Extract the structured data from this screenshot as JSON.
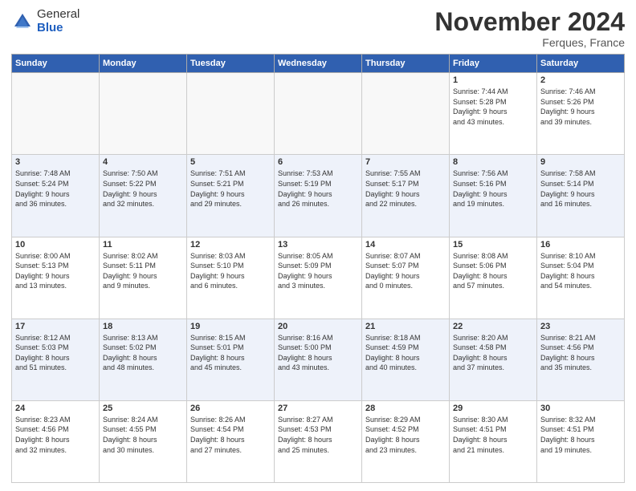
{
  "header": {
    "logo_general": "General",
    "logo_blue": "Blue",
    "month": "November 2024",
    "location": "Ferques, France"
  },
  "weekdays": [
    "Sunday",
    "Monday",
    "Tuesday",
    "Wednesday",
    "Thursday",
    "Friday",
    "Saturday"
  ],
  "weeks": [
    [
      {
        "day": "",
        "info": ""
      },
      {
        "day": "",
        "info": ""
      },
      {
        "day": "",
        "info": ""
      },
      {
        "day": "",
        "info": ""
      },
      {
        "day": "",
        "info": ""
      },
      {
        "day": "1",
        "info": "Sunrise: 7:44 AM\nSunset: 5:28 PM\nDaylight: 9 hours\nand 43 minutes."
      },
      {
        "day": "2",
        "info": "Sunrise: 7:46 AM\nSunset: 5:26 PM\nDaylight: 9 hours\nand 39 minutes."
      }
    ],
    [
      {
        "day": "3",
        "info": "Sunrise: 7:48 AM\nSunset: 5:24 PM\nDaylight: 9 hours\nand 36 minutes."
      },
      {
        "day": "4",
        "info": "Sunrise: 7:50 AM\nSunset: 5:22 PM\nDaylight: 9 hours\nand 32 minutes."
      },
      {
        "day": "5",
        "info": "Sunrise: 7:51 AM\nSunset: 5:21 PM\nDaylight: 9 hours\nand 29 minutes."
      },
      {
        "day": "6",
        "info": "Sunrise: 7:53 AM\nSunset: 5:19 PM\nDaylight: 9 hours\nand 26 minutes."
      },
      {
        "day": "7",
        "info": "Sunrise: 7:55 AM\nSunset: 5:17 PM\nDaylight: 9 hours\nand 22 minutes."
      },
      {
        "day": "8",
        "info": "Sunrise: 7:56 AM\nSunset: 5:16 PM\nDaylight: 9 hours\nand 19 minutes."
      },
      {
        "day": "9",
        "info": "Sunrise: 7:58 AM\nSunset: 5:14 PM\nDaylight: 9 hours\nand 16 minutes."
      }
    ],
    [
      {
        "day": "10",
        "info": "Sunrise: 8:00 AM\nSunset: 5:13 PM\nDaylight: 9 hours\nand 13 minutes."
      },
      {
        "day": "11",
        "info": "Sunrise: 8:02 AM\nSunset: 5:11 PM\nDaylight: 9 hours\nand 9 minutes."
      },
      {
        "day": "12",
        "info": "Sunrise: 8:03 AM\nSunset: 5:10 PM\nDaylight: 9 hours\nand 6 minutes."
      },
      {
        "day": "13",
        "info": "Sunrise: 8:05 AM\nSunset: 5:09 PM\nDaylight: 9 hours\nand 3 minutes."
      },
      {
        "day": "14",
        "info": "Sunrise: 8:07 AM\nSunset: 5:07 PM\nDaylight: 9 hours\nand 0 minutes."
      },
      {
        "day": "15",
        "info": "Sunrise: 8:08 AM\nSunset: 5:06 PM\nDaylight: 8 hours\nand 57 minutes."
      },
      {
        "day": "16",
        "info": "Sunrise: 8:10 AM\nSunset: 5:04 PM\nDaylight: 8 hours\nand 54 minutes."
      }
    ],
    [
      {
        "day": "17",
        "info": "Sunrise: 8:12 AM\nSunset: 5:03 PM\nDaylight: 8 hours\nand 51 minutes."
      },
      {
        "day": "18",
        "info": "Sunrise: 8:13 AM\nSunset: 5:02 PM\nDaylight: 8 hours\nand 48 minutes."
      },
      {
        "day": "19",
        "info": "Sunrise: 8:15 AM\nSunset: 5:01 PM\nDaylight: 8 hours\nand 45 minutes."
      },
      {
        "day": "20",
        "info": "Sunrise: 8:16 AM\nSunset: 5:00 PM\nDaylight: 8 hours\nand 43 minutes."
      },
      {
        "day": "21",
        "info": "Sunrise: 8:18 AM\nSunset: 4:59 PM\nDaylight: 8 hours\nand 40 minutes."
      },
      {
        "day": "22",
        "info": "Sunrise: 8:20 AM\nSunset: 4:58 PM\nDaylight: 8 hours\nand 37 minutes."
      },
      {
        "day": "23",
        "info": "Sunrise: 8:21 AM\nSunset: 4:56 PM\nDaylight: 8 hours\nand 35 minutes."
      }
    ],
    [
      {
        "day": "24",
        "info": "Sunrise: 8:23 AM\nSunset: 4:56 PM\nDaylight: 8 hours\nand 32 minutes."
      },
      {
        "day": "25",
        "info": "Sunrise: 8:24 AM\nSunset: 4:55 PM\nDaylight: 8 hours\nand 30 minutes."
      },
      {
        "day": "26",
        "info": "Sunrise: 8:26 AM\nSunset: 4:54 PM\nDaylight: 8 hours\nand 27 minutes."
      },
      {
        "day": "27",
        "info": "Sunrise: 8:27 AM\nSunset: 4:53 PM\nDaylight: 8 hours\nand 25 minutes."
      },
      {
        "day": "28",
        "info": "Sunrise: 8:29 AM\nSunset: 4:52 PM\nDaylight: 8 hours\nand 23 minutes."
      },
      {
        "day": "29",
        "info": "Sunrise: 8:30 AM\nSunset: 4:51 PM\nDaylight: 8 hours\nand 21 minutes."
      },
      {
        "day": "30",
        "info": "Sunrise: 8:32 AM\nSunset: 4:51 PM\nDaylight: 8 hours\nand 19 minutes."
      }
    ]
  ]
}
